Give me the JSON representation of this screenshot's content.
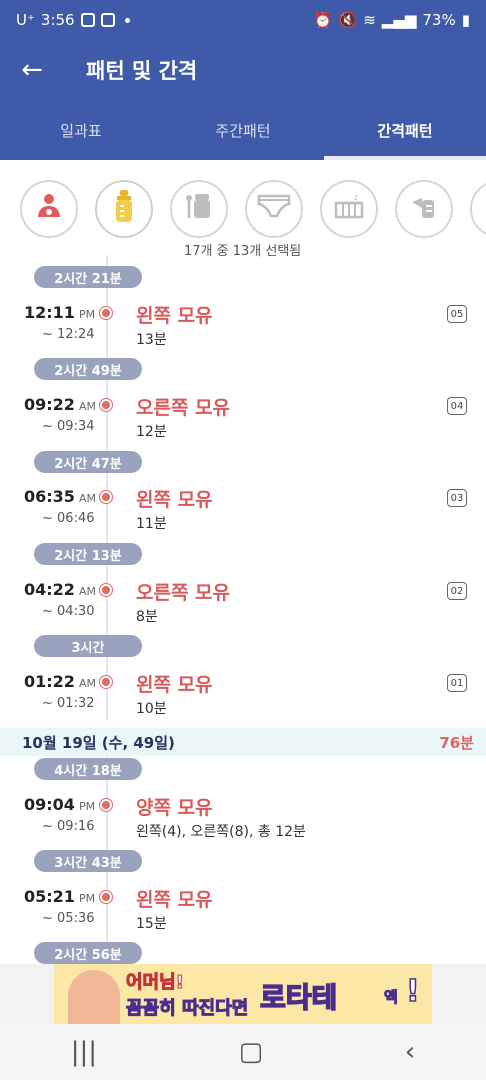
{
  "status": {
    "carrier": "U⁺",
    "time": "3:56",
    "battery": "73%"
  },
  "app_bar": {
    "back_icon": "←",
    "title": "패턴 및 간격"
  },
  "tabs": [
    {
      "label": "일과표"
    },
    {
      "label": "주간패턴"
    },
    {
      "label": "간격패턴"
    }
  ],
  "filters": [
    {
      "icon": "breastfeeding-icon",
      "glyph": "♡"
    },
    {
      "icon": "bottle-icon",
      "glyph": "▮"
    },
    {
      "icon": "food-jar-icon",
      "glyph": "☕"
    },
    {
      "icon": "diaper-icon",
      "glyph": "□"
    },
    {
      "icon": "crib-icon",
      "glyph": "⌂"
    },
    {
      "icon": "pump-icon",
      "glyph": "♦"
    }
  ],
  "selected_count": "17개 중 13개 선택됨",
  "gaps": [
    "2시간 21분",
    "2시간 49분",
    "2시간 47분",
    "2시간 13분",
    "3시간",
    "4시간 18분",
    "3시간 43분",
    "2시간 56분"
  ],
  "entries": [
    {
      "start": "12:11",
      "ampm": "PM",
      "end": "~ 12:24",
      "title": "왼쪽 모유",
      "detail": "13분",
      "badge": "05"
    },
    {
      "start": "09:22",
      "ampm": "AM",
      "end": "~ 09:34",
      "title": "오른쪽 모유",
      "detail": "12분",
      "badge": "04"
    },
    {
      "start": "06:35",
      "ampm": "AM",
      "end": "~ 06:46",
      "title": "왼쪽 모유",
      "detail": "11분",
      "badge": "03"
    },
    {
      "start": "04:22",
      "ampm": "AM",
      "end": "~ 04:30",
      "title": "오른쪽 모유",
      "detail": "8분",
      "badge": "02"
    },
    {
      "start": "01:22",
      "ampm": "AM",
      "end": "~ 01:32",
      "title": "왼쪽 모유",
      "detail": "10분",
      "badge": "01"
    },
    {
      "start": "09:04",
      "ampm": "PM",
      "end": "~ 09:16",
      "title": "양쪽 모유",
      "detail": "왼쪽(4), 오른쪽(8), 총 12분",
      "badge": ""
    },
    {
      "start": "05:21",
      "ampm": "PM",
      "end": "~ 05:36",
      "title": "왼쪽 모유",
      "detail": "15분",
      "badge": ""
    }
  ],
  "date_section": {
    "date": "10월 19일 (수, 49일)",
    "total": "76분"
  },
  "ad": {
    "line1": "어머님!",
    "line2": "꼼꼼히 따진다면",
    "brand": "로타테",
    "suffix": "액",
    "exclaim": "!"
  },
  "nav": {
    "recents": "|||",
    "home": "▢",
    "back": "‹"
  },
  "colors": {
    "primary": "#3f5aa8",
    "feeding_red": "#d85a5a",
    "gap_pill": "#9aa3bd",
    "date_band": "#eaf6f8"
  }
}
